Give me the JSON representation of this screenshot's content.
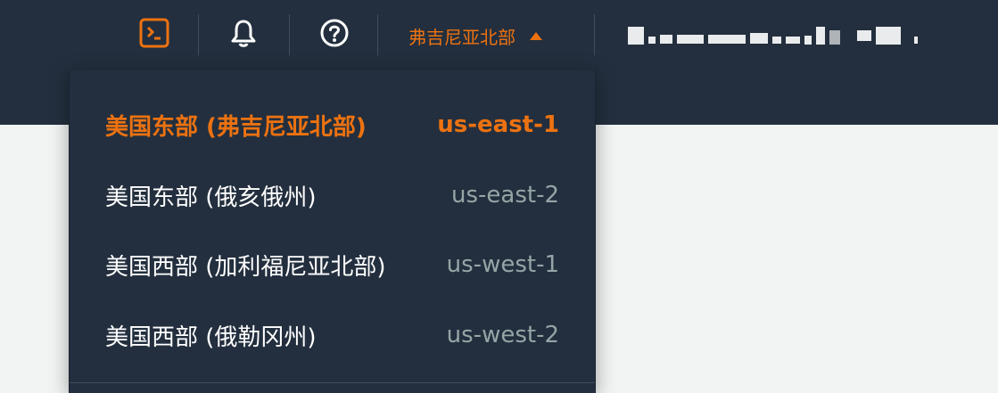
{
  "header": {
    "icons": [
      "cloudshell-icon",
      "bell-icon",
      "help-icon"
    ],
    "region_selector": {
      "label": "弗吉尼亚北部",
      "expanded": true
    },
    "account_label": "",
    "colors": {
      "bar": "#232f3e",
      "accent": "#ec7211"
    }
  },
  "region_menu": {
    "items": [
      {
        "name": "美国东部 (弗吉尼亚北部)",
        "code": "us-east-1",
        "selected": true
      },
      {
        "name": "美国东部 (俄亥俄州)",
        "code": "us-east-2",
        "selected": false
      },
      {
        "name": "美国西部 (加利福尼亚北部)",
        "code": "us-west-1",
        "selected": false
      },
      {
        "name": "美国西部 (俄勒冈州)",
        "code": "us-west-2",
        "selected": false
      }
    ]
  }
}
